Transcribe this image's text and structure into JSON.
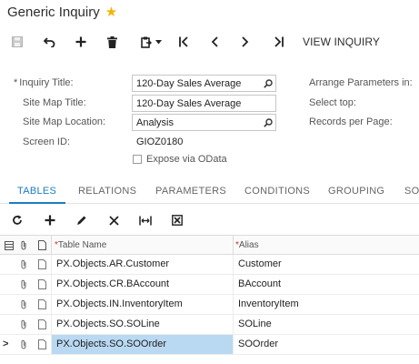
{
  "screen": {
    "title": "Generic Inquiry",
    "favorite_icon": "star-icon"
  },
  "toolbar": {
    "view_inquiry_label": "VIEW INQUIRY"
  },
  "form": {
    "inquiry_title_label": "Inquiry Title:",
    "inquiry_title_required": "*",
    "inquiry_title_value": "120-Day Sales Average",
    "site_map_title_label": "Site Map Title:",
    "site_map_title_value": "120-Day Sales Average",
    "site_map_location_label": "Site Map Location:",
    "site_map_location_value": "Analysis",
    "screen_id_label": "Screen ID:",
    "screen_id_value": "GIOZ0180",
    "expose_odata_label": "Expose via OData",
    "arrange_params_label": "Arrange Parameters in:",
    "select_top_label": "Select top:",
    "records_per_page_label": "Records per Page:"
  },
  "tabs": [
    {
      "label": "TABLES",
      "active": true
    },
    {
      "label": "RELATIONS",
      "active": false
    },
    {
      "label": "PARAMETERS",
      "active": false
    },
    {
      "label": "CONDITIONS",
      "active": false
    },
    {
      "label": "GROUPING",
      "active": false
    },
    {
      "label": "SO",
      "active": false
    }
  ],
  "grid": {
    "columns": [
      {
        "label": "Table Name",
        "required": "*"
      },
      {
        "label": "Alias",
        "required": "*"
      }
    ],
    "rows": [
      {
        "table_name": "PX.Objects.AR.Customer",
        "alias": "Customer",
        "selected": false
      },
      {
        "table_name": "PX.Objects.CR.BAccount",
        "alias": "BAccount",
        "selected": false
      },
      {
        "table_name": "PX.Objects.IN.InventoryItem",
        "alias": "InventoryItem",
        "selected": false
      },
      {
        "table_name": "PX.Objects.SO.SOLine",
        "alias": "SOLine",
        "selected": false
      },
      {
        "table_name": "PX.Objects.SO.SOOrder",
        "alias": "SOOrder",
        "selected": true
      }
    ],
    "current_row_marker": ">"
  },
  "colors": {
    "accent": "#1b7cc0",
    "selection": "#b9d8f2",
    "star": "#f5b301"
  }
}
